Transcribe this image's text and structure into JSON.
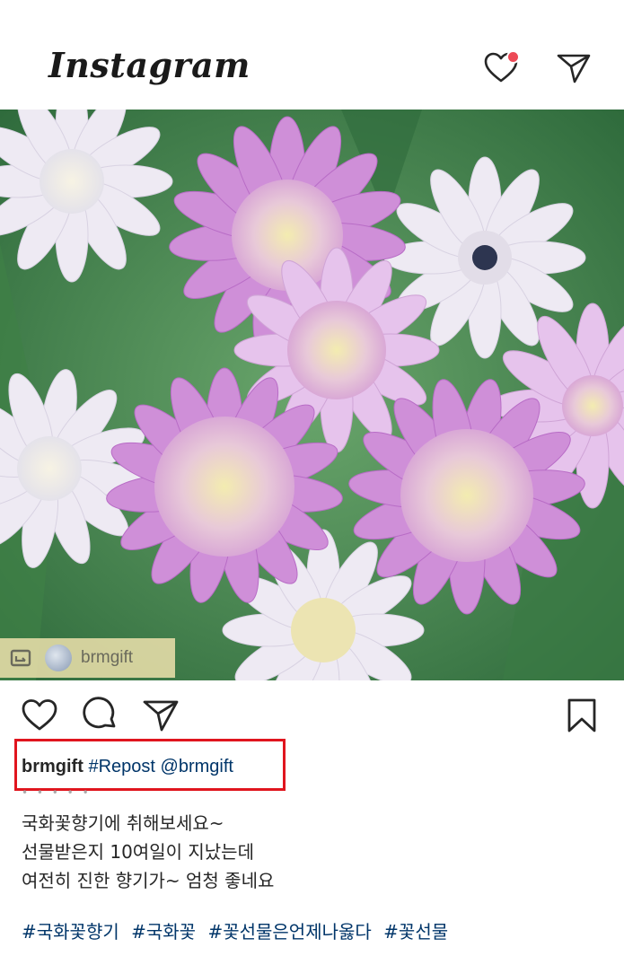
{
  "header": {
    "logo_text": "Instagram",
    "icons": [
      "heart-icon",
      "send-icon"
    ],
    "has_notification_dot": true
  },
  "photo": {
    "description_icon": "flower-photo",
    "repost_badge": {
      "icon": "repost-icon",
      "username": "brmgift"
    }
  },
  "actions": [
    "like-icon",
    "comment-icon",
    "share-icon",
    "bookmark-icon"
  ],
  "caption": {
    "username": "brmgift",
    "tag1": "#Repost",
    "mention": "@brmgift",
    "dots": "• • • • •",
    "lines": [
      "국화꽃향기에 취해보세요~",
      "선물받은지 10여일이 지났는데",
      "여전히 진한 향기가~ 엄청 좋네요"
    ],
    "hashtags": [
      "#국화꽃향기",
      "#국화꽃",
      "#꽃선물은언제나옳다",
      "#꽃선물"
    ]
  },
  "colors": {
    "link": "#003569",
    "highlight": "#e0151e",
    "notification": "#ed4956"
  }
}
